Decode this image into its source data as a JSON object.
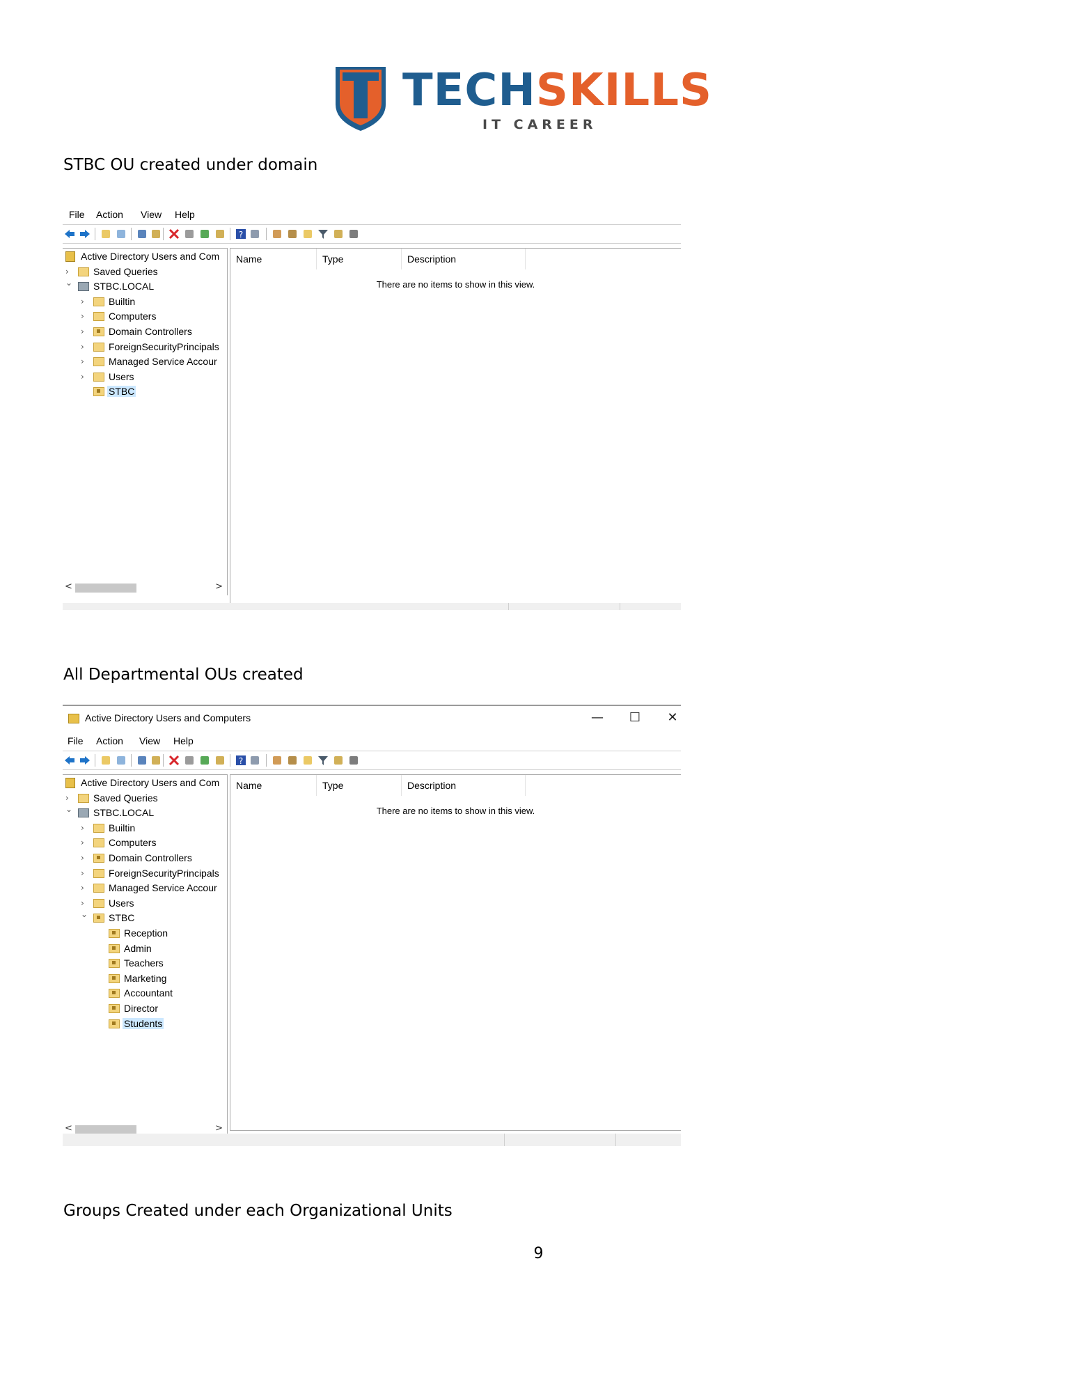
{
  "logo": {
    "part1": "TECH",
    "part2": "SKILLS",
    "subtitle": "IT CAREER"
  },
  "sections": [
    {
      "caption": "STBC OU created under domain"
    },
    {
      "caption": "All Departmental OUs created"
    },
    {
      "caption": "Groups Created under each Organizational Units"
    }
  ],
  "window2": {
    "title": "Active Directory Users and Computers",
    "controls": {
      "minimize": "—",
      "maximize": "☐",
      "close": "✕"
    }
  },
  "menu": [
    "File",
    "Action",
    "View",
    "Help"
  ],
  "list": {
    "columns": [
      "Name",
      "Type",
      "Description"
    ],
    "empty_message": "There are no items to show in this view."
  },
  "tree1": [
    {
      "label": "Active Directory Users and Com",
      "chev": "",
      "icon": "root",
      "indent": 0
    },
    {
      "label": "Saved Queries",
      "chev": ">",
      "icon": "folder",
      "indent": 0
    },
    {
      "label": "STBC.LOCAL",
      "chev": "v",
      "icon": "domain",
      "indent": 0
    },
    {
      "label": "Builtin",
      "chev": ">",
      "icon": "folder",
      "indent": 1
    },
    {
      "label": "Computers",
      "chev": ">",
      "icon": "folder",
      "indent": 1
    },
    {
      "label": "Domain Controllers",
      "chev": ">",
      "icon": "ou",
      "indent": 1
    },
    {
      "label": "ForeignSecurityPrincipals",
      "chev": ">",
      "icon": "folder",
      "indent": 1
    },
    {
      "label": "Managed Service Accour",
      "chev": ">",
      "icon": "folder",
      "indent": 1
    },
    {
      "label": "Users",
      "chev": ">",
      "icon": "folder",
      "indent": 1
    },
    {
      "label": "STBC",
      "chev": "",
      "icon": "ou",
      "indent": 1,
      "selected": true
    }
  ],
  "tree2": [
    {
      "label": "Active Directory Users and Com",
      "chev": "",
      "icon": "root",
      "indent": 0
    },
    {
      "label": "Saved Queries",
      "chev": ">",
      "icon": "folder",
      "indent": 0
    },
    {
      "label": "STBC.LOCAL",
      "chev": "v",
      "icon": "domain",
      "indent": 0
    },
    {
      "label": "Builtin",
      "chev": ">",
      "icon": "folder",
      "indent": 1
    },
    {
      "label": "Computers",
      "chev": ">",
      "icon": "folder",
      "indent": 1
    },
    {
      "label": "Domain Controllers",
      "chev": ">",
      "icon": "ou",
      "indent": 1
    },
    {
      "label": "ForeignSecurityPrincipals",
      "chev": ">",
      "icon": "folder",
      "indent": 1
    },
    {
      "label": "Managed Service Accour",
      "chev": ">",
      "icon": "folder",
      "indent": 1
    },
    {
      "label": "Users",
      "chev": ">",
      "icon": "folder",
      "indent": 1
    },
    {
      "label": "STBC",
      "chev": "v",
      "icon": "ou",
      "indent": 1
    },
    {
      "label": "Reception",
      "chev": "",
      "icon": "ou",
      "indent": 2
    },
    {
      "label": "Admin",
      "chev": "",
      "icon": "ou",
      "indent": 2
    },
    {
      "label": "Teachers",
      "chev": "",
      "icon": "ou",
      "indent": 2
    },
    {
      "label": "Marketing",
      "chev": "",
      "icon": "ou",
      "indent": 2
    },
    {
      "label": "Accountant",
      "chev": "",
      "icon": "ou",
      "indent": 2
    },
    {
      "label": "Director",
      "chev": "",
      "icon": "ou",
      "indent": 2
    },
    {
      "label": "Students",
      "chev": "",
      "icon": "ou",
      "indent": 2,
      "selected": true
    }
  ],
  "toolbar_icons": [
    "back-icon",
    "forward-icon",
    "up-folder-icon",
    "show-hide-tree-icon",
    "cut-icon",
    "paste-icon",
    "delete-icon",
    "properties-icon",
    "refresh-icon",
    "export-icon",
    "help-icon",
    "console-tree-icon",
    "new-user-icon",
    "new-group-icon",
    "new-ou-icon",
    "filter-icon",
    "find-icon",
    "add-to-group-icon"
  ],
  "colors": {
    "accent_blue": "#1f5d8f",
    "accent_orange": "#e4602b",
    "selection": "#cce8ff"
  },
  "page_number": "9"
}
